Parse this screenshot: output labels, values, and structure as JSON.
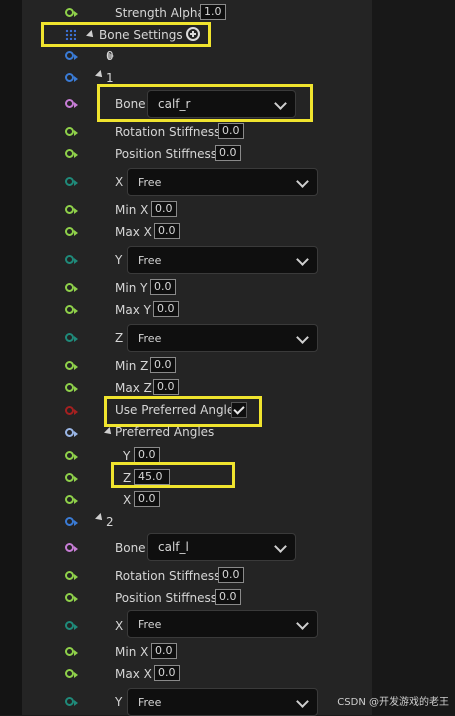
{
  "top": {
    "strength_alpha_label": "Strength Alpha",
    "strength_alpha_value": "1.0"
  },
  "bone_settings": {
    "label": "Bone Settings"
  },
  "indices": {
    "first": "0",
    "second": "1",
    "third": "2"
  },
  "bone1": {
    "bone_label": "Bone",
    "bone_value": "calf_r",
    "rotation_stiffness_label": "Rotation Stiffness",
    "rotation_stiffness_value": "0.0",
    "position_stiffness_label": "Position Stiffness",
    "position_stiffness_value": "0.0",
    "x_label": "X",
    "x_value": "Free",
    "min_x_label": "Min X",
    "min_x_value": "0.0",
    "max_x_label": "Max X",
    "max_x_value": "0.0",
    "y_label": "Y",
    "y_value": "Free",
    "min_y_label": "Min Y",
    "min_y_value": "0.0",
    "max_y_label": "Max Y",
    "max_y_value": "0.0",
    "z_label": "Z",
    "z_value": "Free",
    "min_z_label": "Min Z",
    "min_z_value": "0.0",
    "max_z_label": "Max Z",
    "max_z_value": "0.0",
    "use_preferred_angles_label": "Use Preferred Angles",
    "preferred_angles_label": "Preferred Angles",
    "pref_y_label": "Y",
    "pref_y_value": "0.0",
    "pref_z_label": "Z",
    "pref_z_value": "45.0",
    "pref_x_label": "X",
    "pref_x_value": "0.0"
  },
  "bone2": {
    "bone_label": "Bone",
    "bone_value": "calf_l",
    "rotation_stiffness_label": "Rotation Stiffness",
    "rotation_stiffness_value": "0.0",
    "position_stiffness_label": "Position Stiffness",
    "position_stiffness_value": "0.0",
    "x_label": "X",
    "x_value": "Free",
    "min_x_label": "Min X",
    "min_x_value": "0.0",
    "max_x_label": "Max X",
    "max_x_value": "0.0",
    "y_label": "Y",
    "y_value": "Free"
  },
  "watermark": "CSDN @开发游戏的老王"
}
